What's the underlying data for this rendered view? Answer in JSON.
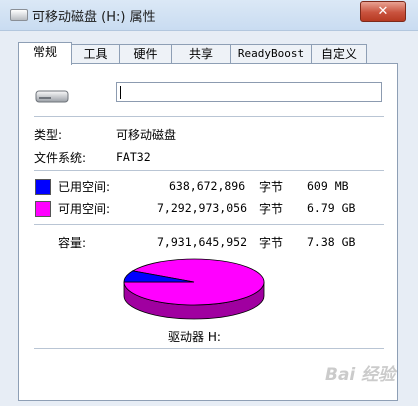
{
  "window": {
    "title": "可移动磁盘 (H:) 属性",
    "close_glyph": "✕"
  },
  "tabs": [
    {
      "label": "常规",
      "active": true
    },
    {
      "label": "工具",
      "active": false
    },
    {
      "label": "硬件",
      "active": false
    },
    {
      "label": "共享",
      "active": false
    },
    {
      "label": "ReadyBoost",
      "active": false
    },
    {
      "label": "自定义",
      "active": false
    }
  ],
  "general": {
    "volume_label_value": "",
    "type_label": "类型:",
    "type_value": "可移动磁盘",
    "fs_label": "文件系统:",
    "fs_value": "FAT32",
    "used": {
      "label": "已用空间:",
      "bytes": "638,672,896",
      "unit": "字节",
      "size": "609 MB",
      "color": "#0000ff"
    },
    "free": {
      "label": "可用空间:",
      "bytes": "7,292,973,056",
      "unit": "字节",
      "size": "6.79 GB",
      "color": "#ff00ff"
    },
    "capacity": {
      "label": "容量:",
      "bytes": "7,931,645,952",
      "unit": "字节",
      "size": "7.38 GB"
    },
    "drive_label": "驱动器 H:",
    "used_fraction": 0.0805
  },
  "watermark": "Bai 经验"
}
